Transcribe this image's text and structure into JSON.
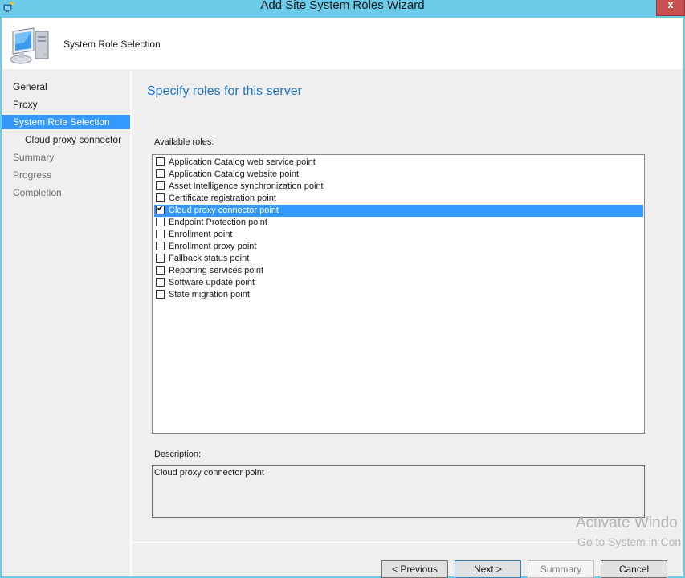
{
  "window": {
    "title": "Add Site System Roles Wizard",
    "close_label": "x"
  },
  "header": {
    "title": "System Role Selection",
    "icon": "computer-icon"
  },
  "nav": {
    "items": [
      {
        "label": "General",
        "state": "normal"
      },
      {
        "label": "Proxy",
        "state": "normal"
      },
      {
        "label": "System Role Selection",
        "state": "active"
      },
      {
        "label": "Cloud proxy connector",
        "state": "sub"
      },
      {
        "label": "Summary",
        "state": "disabled"
      },
      {
        "label": "Progress",
        "state": "disabled"
      },
      {
        "label": "Completion",
        "state": "disabled"
      }
    ]
  },
  "main": {
    "heading": "Specify roles for this server",
    "available_roles_label": "Available roles:",
    "roles": [
      {
        "label": "Application Catalog web service point",
        "checked": false,
        "selected": false
      },
      {
        "label": "Application Catalog website point",
        "checked": false,
        "selected": false
      },
      {
        "label": "Asset Intelligence synchronization point",
        "checked": false,
        "selected": false
      },
      {
        "label": "Certificate registration point",
        "checked": false,
        "selected": false
      },
      {
        "label": "Cloud proxy connector point",
        "checked": true,
        "selected": true
      },
      {
        "label": "Endpoint Protection point",
        "checked": false,
        "selected": false
      },
      {
        "label": "Enrollment point",
        "checked": false,
        "selected": false
      },
      {
        "label": "Enrollment proxy point",
        "checked": false,
        "selected": false
      },
      {
        "label": "Fallback status point",
        "checked": false,
        "selected": false
      },
      {
        "label": "Reporting services point",
        "checked": false,
        "selected": false
      },
      {
        "label": "Software update point",
        "checked": false,
        "selected": false
      },
      {
        "label": "State migration point",
        "checked": false,
        "selected": false
      }
    ],
    "description_label": "Description:",
    "description_text": "Cloud proxy connector point"
  },
  "buttons": {
    "previous": "< Previous",
    "next": "Next >",
    "summary": "Summary",
    "cancel": "Cancel"
  },
  "watermark": {
    "line1": "Activate Windo",
    "line2": "Go to System in Con"
  },
  "colors": {
    "titlebar": "#6ccbe9",
    "accent": "#3399ff",
    "heading": "#1e6fc0",
    "close": "#c75050"
  }
}
